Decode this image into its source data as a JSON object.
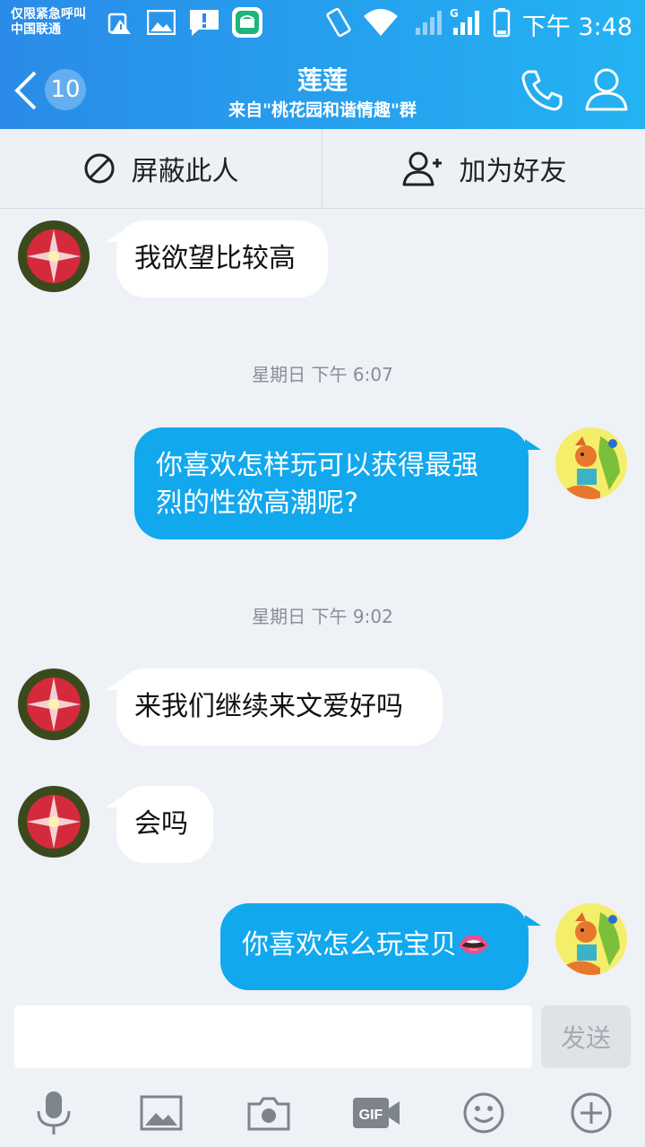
{
  "status_bar": {
    "carrier_line1": "仅限紧急呼叫",
    "carrier_line2": "中国联通",
    "time": "下午 3:48",
    "network_label": "G"
  },
  "header": {
    "back_count": "10",
    "title": "莲莲",
    "subtitle": "来自\"桃花园和谐情趣\"群"
  },
  "actions": {
    "block_label": "屏蔽此人",
    "add_friend_label": "加为好友"
  },
  "messages": [
    {
      "side": "in",
      "text": "我欲望比较高"
    },
    {
      "type": "time",
      "text": "星期日 下午 6:07"
    },
    {
      "side": "out",
      "text_line1": "你喜欢怎样玩可以获得最强",
      "text_line2": "烈的性欲高潮呢?"
    },
    {
      "type": "time",
      "text": "星期日 下午 9:02"
    },
    {
      "side": "in",
      "text": "来我们继续来文爱好吗"
    },
    {
      "side": "in",
      "text": "会吗"
    },
    {
      "side": "out",
      "text": "你喜欢怎么玩宝贝",
      "emoji": "👄"
    }
  ],
  "input": {
    "placeholder": "",
    "value": ""
  },
  "send_label": "发送",
  "toolbar_icons": [
    "microphone-icon",
    "image-icon",
    "camera-icon",
    "gif-icon",
    "emoji-icon",
    "plus-icon"
  ],
  "colors": {
    "header": "#23a8f0",
    "bubble_out": "#12a8ee",
    "bubble_in": "#ffffff",
    "background": "#eef1f6"
  }
}
